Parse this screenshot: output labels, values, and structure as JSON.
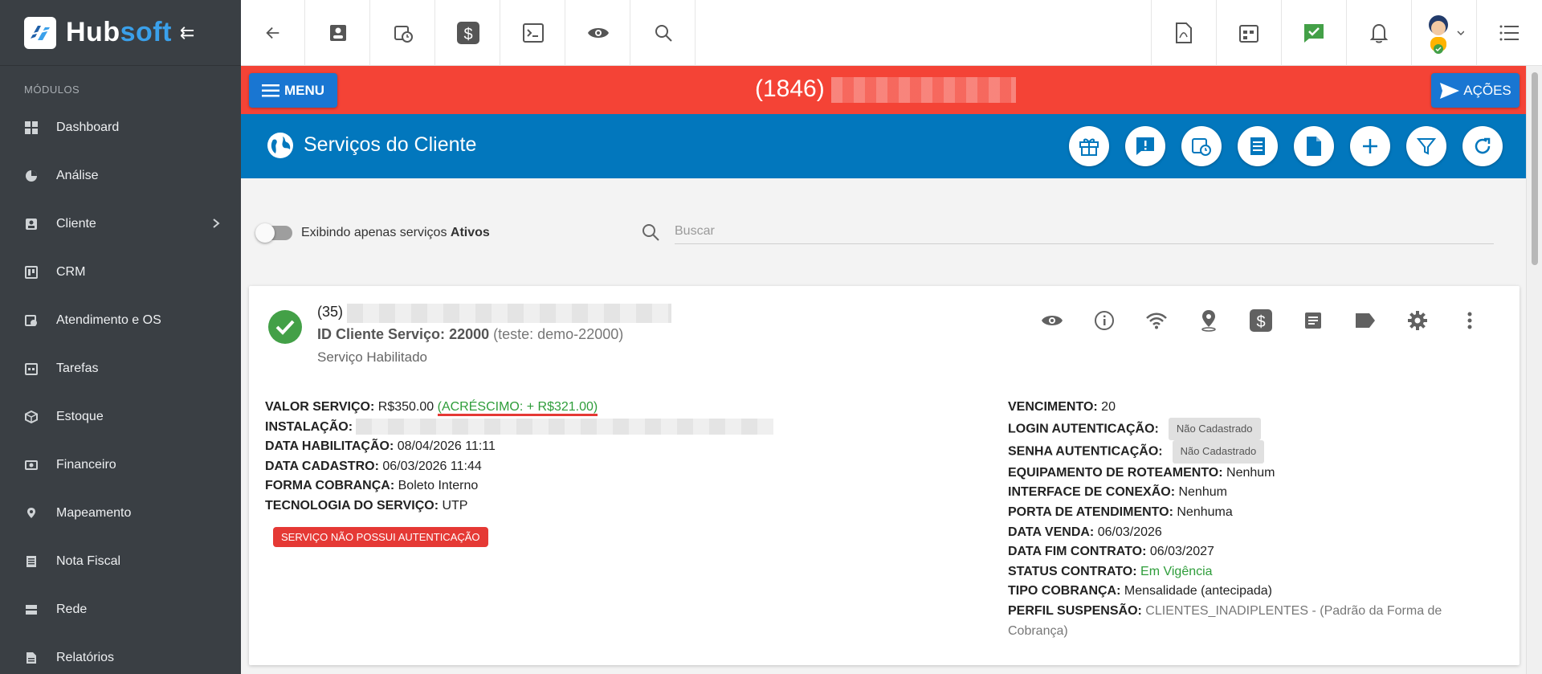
{
  "brand": {
    "name_part1": "Hub",
    "name_part2": "soft"
  },
  "sidebar": {
    "section_label": "MÓDULOS",
    "items": [
      {
        "label": "Dashboard",
        "icon": "dashboard-icon"
      },
      {
        "label": "Análise",
        "icon": "pie-chart-icon"
      },
      {
        "label": "Cliente",
        "icon": "contact-card-icon",
        "has_submenu": true
      },
      {
        "label": "CRM",
        "icon": "kanban-icon"
      },
      {
        "label": "Atendimento e OS",
        "icon": "calendar-clock-icon"
      },
      {
        "label": "Tarefas",
        "icon": "calendar-tasks-icon"
      },
      {
        "label": "Estoque",
        "icon": "package-icon"
      },
      {
        "label": "Financeiro",
        "icon": "money-icon"
      },
      {
        "label": "Mapeamento",
        "icon": "map-pin-icon"
      },
      {
        "label": "Nota Fiscal",
        "icon": "receipt-icon"
      },
      {
        "label": "Rede",
        "icon": "server-icon"
      },
      {
        "label": "Relatórios",
        "icon": "report-icon"
      }
    ]
  },
  "redbar": {
    "menu_label": "MENU",
    "client_code": "(1846)",
    "actions_label": "AÇÕES"
  },
  "header": {
    "title": "Serviços do Cliente"
  },
  "filter": {
    "toggle_label": "Exibindo apenas serviços",
    "toggle_label_bold": "Ativos",
    "search_placeholder": "Buscar"
  },
  "service": {
    "code": "(35)",
    "id_label": "ID Cliente Serviço:",
    "id_value": "22000",
    "id_note": "(teste: demo-22000)",
    "status": "Serviço Habilitado",
    "left": {
      "valor_label": "VALOR SERVIÇO:",
      "valor_value": "R$350.00",
      "acrescimo": "(ACRÉSCIMO: + R$321.00)",
      "instalacao_label": "INSTALAÇÃO:",
      "habilitacao_label": "DATA HABILITAÇÃO:",
      "habilitacao_value": "08/04/2026 11:11",
      "cadastro_label": "DATA CADASTRO:",
      "cadastro_value": "06/03/2026 11:44",
      "cobranca_label": "FORMA COBRANÇA:",
      "cobranca_value": "Boleto Interno",
      "tecnologia_label": "TECNOLOGIA DO SERVIÇO:",
      "tecnologia_value": "UTP",
      "no_auth_badge": "SERVIÇO NÃO POSSUI AUTENTICAÇÃO"
    },
    "right": {
      "vencimento_label": "VENCIMENTO:",
      "vencimento_value": "20",
      "login_label": "LOGIN AUTENTICAÇÃO:",
      "login_chip": "Não Cadastrado",
      "senha_label": "SENHA AUTENTICAÇÃO:",
      "senha_chip": "Não Cadastrado",
      "equip_label": "EQUIPAMENTO DE ROTEAMENTO:",
      "equip_value": "Nenhum",
      "interface_label": "INTERFACE DE CONEXÃO:",
      "interface_value": "Nenhum",
      "porta_label": "PORTA DE ATENDIMENTO:",
      "porta_value": "Nenhuma",
      "venda_label": "DATA VENDA:",
      "venda_value": "06/03/2026",
      "fim_label": "DATA FIM CONTRATO:",
      "fim_value": "06/03/2027",
      "status_label": "STATUS CONTRATO:",
      "status_value": "Em Vigência",
      "tipo_label": "TIPO COBRANÇA:",
      "tipo_value": "Mensalidade (antecipada)",
      "perfil_label": "PERFIL SUSPENSÃO:",
      "perfil_value": "CLIENTES_INADIPLENTES",
      "perfil_note_line1": " - (Padrão da Forma de",
      "perfil_note_line2": "Cobrança)"
    }
  },
  "colors": {
    "sidebar": "#3a3f44",
    "red_bar": "#f44336",
    "blue_bar": "#0277bd",
    "button_blue": "#1976d2",
    "success_green": "#43a047"
  }
}
